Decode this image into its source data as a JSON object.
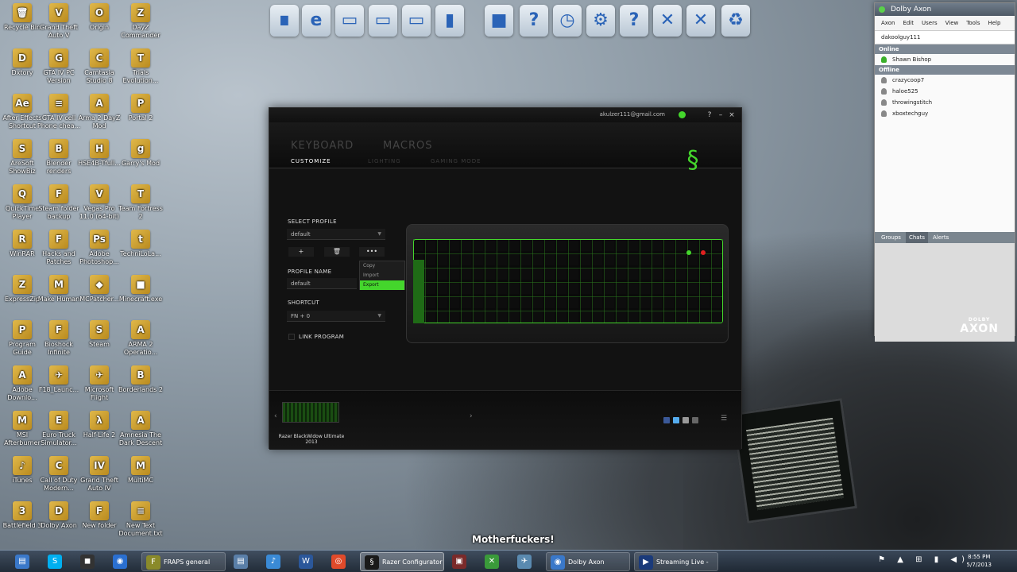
{
  "desktop_icons": [
    {
      "label": "Recycle Bin",
      "glyph": "🗑"
    },
    {
      "label": "Grand Theft Auto V",
      "glyph": "V"
    },
    {
      "label": "Origin",
      "glyph": "O"
    },
    {
      "label": "DayZ Commander",
      "glyph": "Z"
    },
    {
      "label": "Dxtory",
      "glyph": "D"
    },
    {
      "label": "GTA IV PC Version",
      "glyph": "G"
    },
    {
      "label": "Camtasia Studio 8",
      "glyph": "C"
    },
    {
      "label": "Trials Evolution...",
      "glyph": "T"
    },
    {
      "label": "After Effects Shortcut",
      "glyph": "Ae"
    },
    {
      "label": "GTA IV cell Phone chea...",
      "glyph": "≡"
    },
    {
      "label": "Arma 2 DayZ Mod",
      "glyph": "A"
    },
    {
      "label": "Portal 2",
      "glyph": "P"
    },
    {
      "label": "AreSoft ShowBiz",
      "glyph": "S"
    },
    {
      "label": "Blender renders",
      "glyph": "B"
    },
    {
      "label": "HSE4B-Tfull...",
      "glyph": "H"
    },
    {
      "label": "Garry's Mod",
      "glyph": "g"
    },
    {
      "label": "QuickTime Player",
      "glyph": "Q"
    },
    {
      "label": "Steam folder backup",
      "glyph": "F"
    },
    {
      "label": "Vegas Pro 11.0 (64-bit)",
      "glyph": "V"
    },
    {
      "label": "Team Fortress 2",
      "glyph": "T"
    },
    {
      "label": "WinRAR",
      "glyph": "R"
    },
    {
      "label": "Hacks and Patches",
      "glyph": "F"
    },
    {
      "label": "Adobe Photoshop...",
      "glyph": "Ps"
    },
    {
      "label": "TechniLoLa...",
      "glyph": "t"
    },
    {
      "label": "ExpressZip",
      "glyph": "Z"
    },
    {
      "label": "Make Human",
      "glyph": "M"
    },
    {
      "label": "MCPatcher...",
      "glyph": "◆"
    },
    {
      "label": "Minecraft.exe",
      "glyph": "■"
    },
    {
      "label": "Program Guide",
      "glyph": "P"
    },
    {
      "label": "Bioshock Infinite",
      "glyph": "F"
    },
    {
      "label": "Steam",
      "glyph": "S"
    },
    {
      "label": "ARMA 2 Operatio...",
      "glyph": "A"
    },
    {
      "label": "Adobe Downlo...",
      "glyph": "A"
    },
    {
      "label": "F18_Launc...",
      "glyph": "✈"
    },
    {
      "label": "Microsoft Flight",
      "glyph": "✈"
    },
    {
      "label": "Borderlands 2",
      "glyph": "B"
    },
    {
      "label": "MSI Afterburner",
      "glyph": "M"
    },
    {
      "label": "Euro Truck Simulator...",
      "glyph": "E"
    },
    {
      "label": "Half-Life 2",
      "glyph": "λ"
    },
    {
      "label": "Amnesia The Dark Descent",
      "glyph": "A"
    },
    {
      "label": "iTunes",
      "glyph": "♪"
    },
    {
      "label": "Call of Duty Modern...",
      "glyph": "C"
    },
    {
      "label": "Grand Theft Auto IV",
      "glyph": "IV"
    },
    {
      "label": "MultiMC",
      "glyph": "M"
    },
    {
      "label": "Battlefield 3",
      "glyph": "3"
    },
    {
      "label": "Dolby Axon",
      "glyph": "D"
    },
    {
      "label": "New folder",
      "glyph": "F"
    },
    {
      "label": "New Text Document.txt",
      "glyph": "≡"
    }
  ],
  "top_icons": [
    "∎",
    "e",
    "▭",
    "▭",
    "▭",
    "▮",
    "■",
    "?",
    "◷",
    "⚙",
    "?",
    "✕",
    "✕",
    "♻"
  ],
  "razer": {
    "account": "akulzer111@gmail.com",
    "win_buttons": [
      "?",
      "–",
      "×"
    ],
    "tabs": {
      "keyboard": "KEYBOARD",
      "macros": "MACROS"
    },
    "subtabs": {
      "customize": "CUSTOMIZE",
      "lighting": "LIGHTING",
      "gaming_mode": "GAMING MODE"
    },
    "logo": "§",
    "select_profile_label": "SELECT PROFILE",
    "select_profile_value": "default",
    "add_btn": "+",
    "delete_btn": "🗑",
    "more_btn": "•••",
    "menu_items": [
      "Copy",
      "Import",
      "Export"
    ],
    "profile_name_label": "PROFILE NAME",
    "profile_name_value": "default",
    "shortcut_label": "SHORTCUT",
    "shortcut_value": "FN + 0",
    "link_program_label": "LINK PROGRAM",
    "device_name": "Razer BlackWidow Ultimate 2013",
    "prev_arrow": "‹",
    "next_arrow": "›",
    "menu_icon": "☰",
    "accent": "#44d62c"
  },
  "axon": {
    "title": "Dolby Axon",
    "menu": [
      "Axon",
      "Edit",
      "Users",
      "View",
      "Tools",
      "Help"
    ],
    "user": "dakoolguy111",
    "online_label": "Online",
    "online": [
      "Shawn Bishop"
    ],
    "offline_label": "Offline",
    "offline": [
      "crazycoop7",
      "haloe525",
      "throwingstitch",
      "xboxtechguy"
    ],
    "tabs": [
      "Groups",
      "Chats",
      "Alerts"
    ],
    "logo_small": "DOLBY",
    "logo": "AXON"
  },
  "subtitle": "Motherfuckers!",
  "taskbar": {
    "items": [
      {
        "label": "",
        "glyph": "▤",
        "color": "#3a78c9"
      },
      {
        "label": "",
        "glyph": "S",
        "color": "#00aff0"
      },
      {
        "label": "",
        "glyph": "◼",
        "color": "#333333"
      },
      {
        "label": "",
        "glyph": "◉",
        "color": "#2a6fd0"
      },
      {
        "label": "FRAPS general",
        "glyph": "F",
        "color": "#8a8a2a"
      },
      {
        "label": "",
        "glyph": "▤",
        "color": "#5a7fa8"
      },
      {
        "label": "",
        "glyph": "♪",
        "color": "#3a8ad6"
      },
      {
        "label": "",
        "glyph": "W",
        "color": "#2b579a"
      },
      {
        "label": "",
        "glyph": "◎",
        "color": "#e04a2a"
      },
      {
        "label": "Razer Configurator",
        "glyph": "§",
        "color": "#1a1a1a"
      },
      {
        "label": "",
        "glyph": "▣",
        "color": "#7a2a2a"
      },
      {
        "label": "",
        "glyph": "✕",
        "color": "#3a9a3a"
      },
      {
        "label": "",
        "glyph": "✈",
        "color": "#5a8ab0"
      },
      {
        "label": "Dolby Axon",
        "glyph": "◉",
        "color": "#3a78c9"
      },
      {
        "label": "Streaming Live - l...",
        "glyph": "▶",
        "color": "#1a3a7a"
      }
    ],
    "tray": "⚑ ▲ ⊞ ▮ ◀)",
    "time": "8:55 PM",
    "date": "5/7/2013"
  }
}
